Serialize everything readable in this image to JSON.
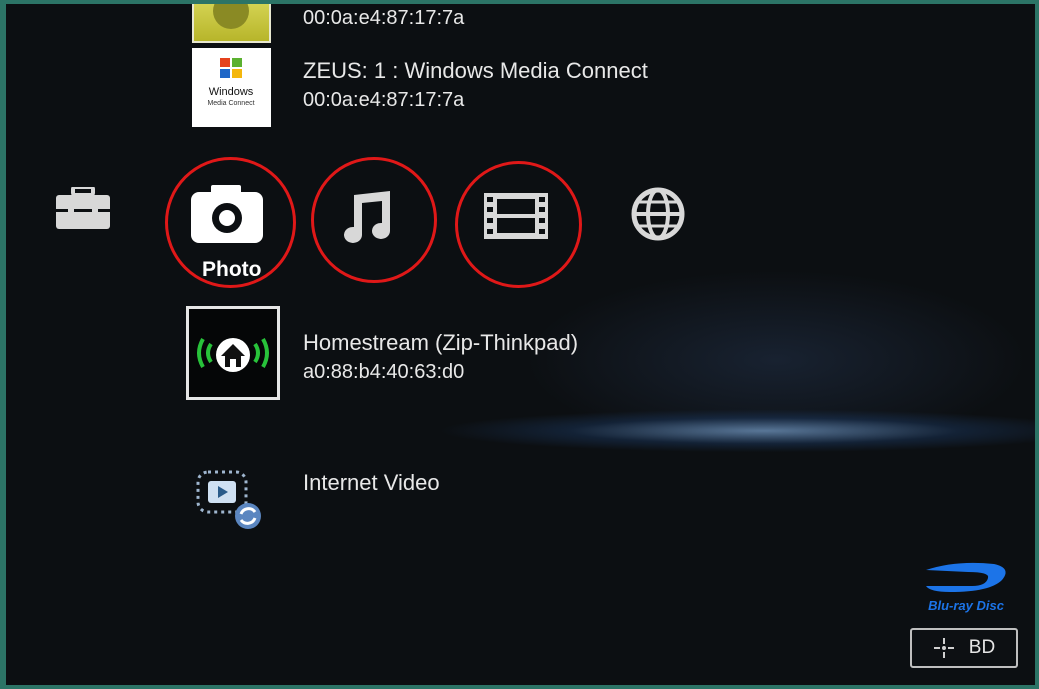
{
  "devices": [
    {
      "name": "",
      "mac": "00:0a:e4:87:17:7a",
      "logo_text": ""
    },
    {
      "name": "ZEUS: 1 : Windows Media Connect",
      "mac": "00:0a:e4:87:17:7a",
      "logo_text": "Windows",
      "logo_subtext": "Media Connect"
    },
    {
      "name": "Homestream (Zip-Thinkpad)",
      "mac": "a0:88:b4:40:63:d0"
    },
    {
      "name": "Internet Video"
    }
  ],
  "categories": {
    "selected_label": "Photo",
    "items": [
      "settings",
      "photo",
      "music",
      "video",
      "network"
    ]
  },
  "footer": {
    "bluray_logo_text": "Blu-ray Disc",
    "bd_button_label": "BD"
  },
  "colors": {
    "highlight_ring": "#e01818",
    "green_signal": "#28c23a",
    "frame_teal": "#2c7466"
  }
}
